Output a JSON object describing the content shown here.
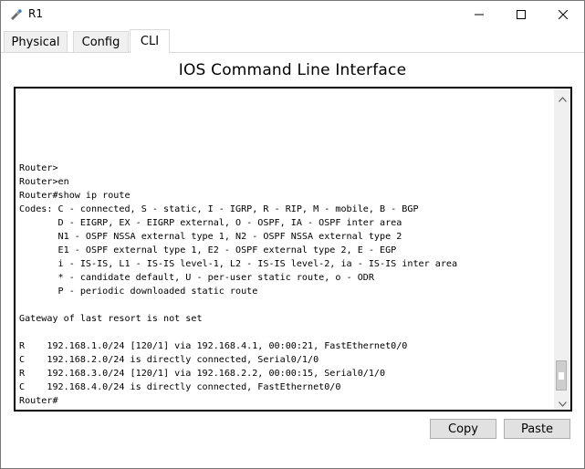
{
  "window": {
    "title": "R1",
    "icon": "router-icon",
    "controls": {
      "minimize_icon": "minimize-icon",
      "maximize_icon": "maximize-icon",
      "close_icon": "close-icon"
    }
  },
  "tabs": [
    {
      "label": "Physical",
      "active": false
    },
    {
      "label": "Config",
      "active": false
    },
    {
      "label": "CLI",
      "active": true
    }
  ],
  "cli": {
    "heading": "IOS Command Line Interface",
    "lines": [
      "Router>",
      "Router>en",
      "Router#show ip route",
      "Codes: C - connected, S - static, I - IGRP, R - RIP, M - mobile, B - BGP",
      "       D - EIGRP, EX - EIGRP external, O - OSPF, IA - OSPF inter area",
      "       N1 - OSPF NSSA external type 1, N2 - OSPF NSSA external type 2",
      "       E1 - OSPF external type 1, E2 - OSPF external type 2, E - EGP",
      "       i - IS-IS, L1 - IS-IS level-1, L2 - IS-IS level-2, ia - IS-IS inter area",
      "       * - candidate default, U - per-user static route, o - ODR",
      "       P - periodic downloaded static route",
      "",
      "Gateway of last resort is not set",
      "",
      "R    192.168.1.0/24 [120/1] via 192.168.4.1, 00:00:21, FastEthernet0/0",
      "C    192.168.2.0/24 is directly connected, Serial0/1/0",
      "R    192.168.3.0/24 [120/1] via 192.168.2.2, 00:00:15, Serial0/1/0",
      "C    192.168.4.0/24 is directly connected, FastEthernet0/0",
      "Router#"
    ]
  },
  "buttons": {
    "copy": "Copy",
    "paste": "Paste"
  },
  "colors": {
    "terminal_border": "#000000",
    "button_bg": "#e1e1e1",
    "scrollbar_bg": "#f0f0f0"
  }
}
